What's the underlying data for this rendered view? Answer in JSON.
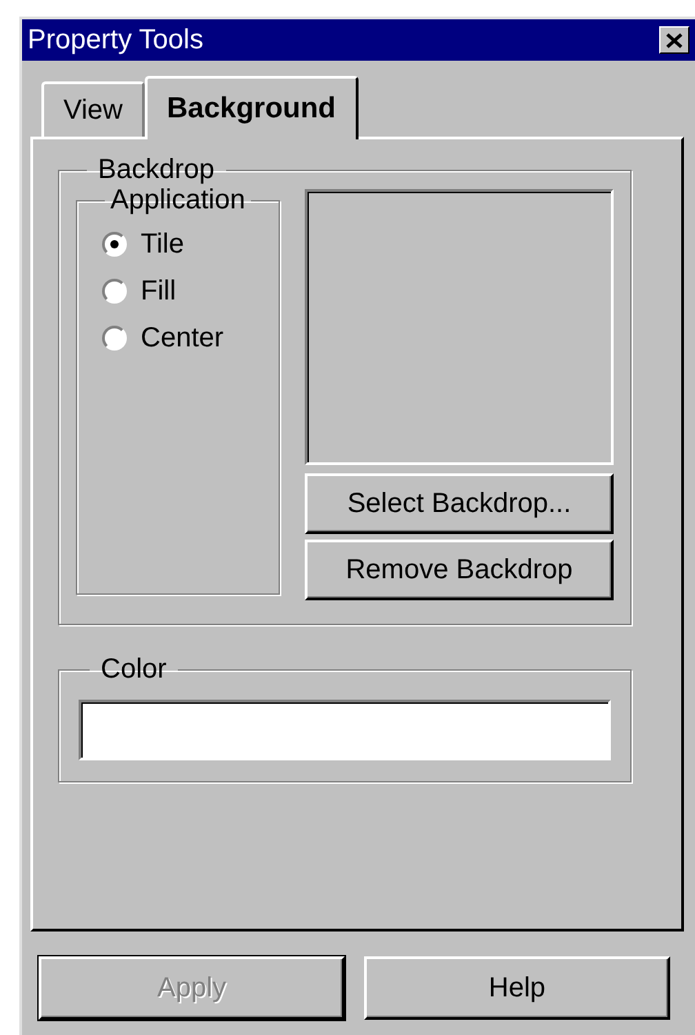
{
  "window": {
    "title": "Property Tools"
  },
  "tabs": [
    {
      "label": "View",
      "selected": false
    },
    {
      "label": "Background",
      "selected": true
    }
  ],
  "backdrop": {
    "title": "Backdrop",
    "application": {
      "title": "Application",
      "options": [
        {
          "label": "Tile",
          "selected": true
        },
        {
          "label": "Fill",
          "selected": false
        },
        {
          "label": "Center",
          "selected": false
        }
      ]
    },
    "buttons": [
      "Select Backdrop...",
      "Remove Backdrop"
    ]
  },
  "color": {
    "title": "Color"
  },
  "buttons": [
    {
      "label": "Apply",
      "disabled": true
    },
    {
      "label": "Help",
      "disabled": false
    }
  ]
}
